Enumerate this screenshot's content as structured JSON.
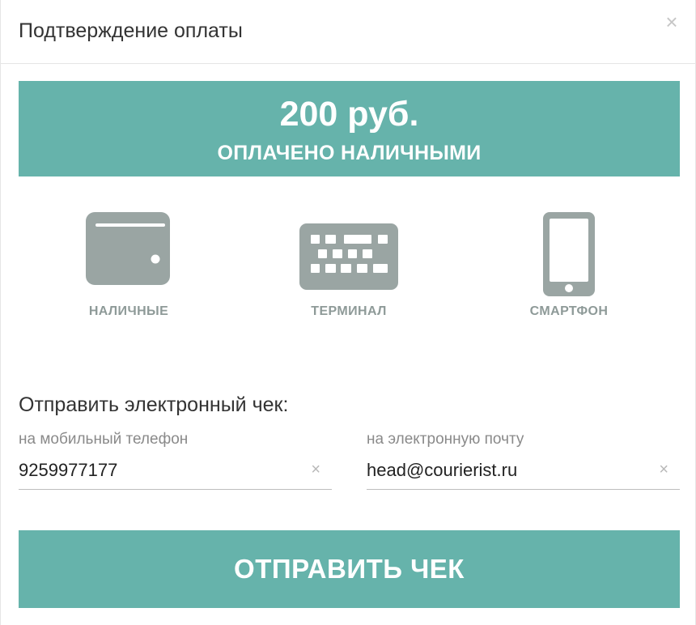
{
  "dialog": {
    "title": "Подтверждение оплаты",
    "close_symbol": "×"
  },
  "banner": {
    "amount": "200 руб.",
    "status": "ОПЛАЧЕНО НАЛИЧНЫМИ",
    "color": "#66b3ab"
  },
  "methods": [
    {
      "label": "НАЛИЧНЫЕ",
      "icon": "wallet-icon"
    },
    {
      "label": "ТЕРМИНАЛ",
      "icon": "keyboard-icon"
    },
    {
      "label": "СМАРТФОН",
      "icon": "smartphone-icon"
    }
  ],
  "receipt": {
    "heading": "Отправить электронный чек:",
    "phone": {
      "label": "на мобильный телефон",
      "value": "9259977177",
      "clear_symbol": "×"
    },
    "email": {
      "label": "на электронную почту",
      "value": "head@courierist.ru",
      "clear_symbol": "×"
    },
    "send_label": "ОТПРАВИТЬ ЧЕК"
  },
  "colors": {
    "accent": "#66b3ab",
    "icon": "#9aa5a3",
    "icon_label": "#8e9a98"
  }
}
